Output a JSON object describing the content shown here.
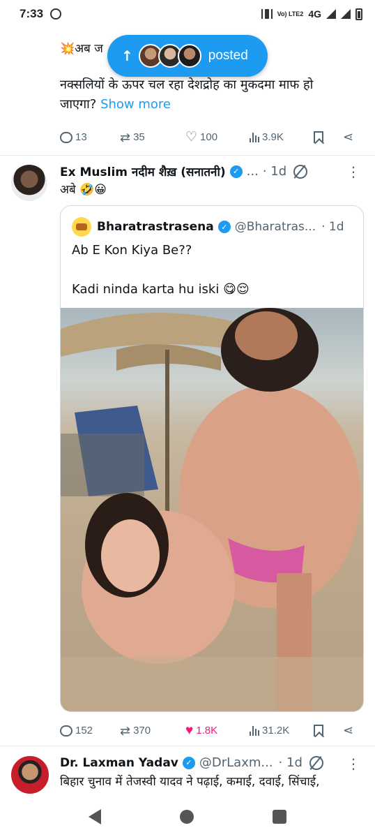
{
  "status_bar": {
    "time": "7:33",
    "volte": "Vo) LTE2",
    "network": "4G"
  },
  "posted_pill": {
    "label": "posted"
  },
  "prev_tweet": {
    "line1": "💥अब ज",
    "text": "नक्सलियों के ऊपर चल रहा देशद्रोह का मुकदमा माफ हो जाएगा?",
    "show_more": "Show more",
    "stats": {
      "replies": "13",
      "reposts": "35",
      "likes": "100",
      "views": "3.9K"
    }
  },
  "tweet": {
    "name": "Ex Muslim नदीम शैख़ (सनातनी)",
    "ellipsis": "...",
    "time": "· 1d",
    "text": "अबे 🤣😀",
    "quote": {
      "name": "Bharatrastrasena",
      "handle": "@Bharatras...",
      "time": "· 1d",
      "text": "Ab E Kon Kiya Be??\n\nKadi ninda karta hu iski 😋😌"
    },
    "stats": {
      "replies": "152",
      "reposts": "370",
      "likes": "1.8K",
      "views": "31.2K"
    }
  },
  "next_tweet": {
    "name": "Dr. Laxman Yadav",
    "handle": "@DrLaxm...",
    "time": "· 1d",
    "text": "बिहार चुनाव में तेजस्वी यादव ने पढ़ाई, कमाई, दवाई, सिंचाई,"
  },
  "colors": {
    "accent": "#1d9bf0",
    "like_active": "#f91880",
    "muted": "#536471"
  }
}
